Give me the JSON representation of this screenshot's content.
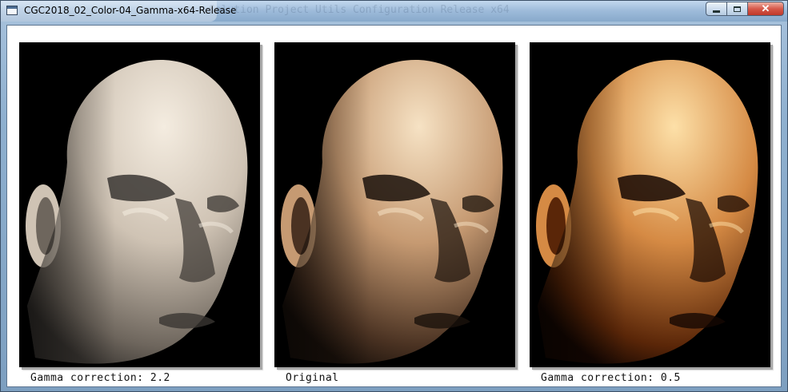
{
  "window": {
    "title": "CGC2018_02_Color-04_Gamma-x64-Release",
    "background_text": "Solution Project Utils Configuration Release x64",
    "buttons": {
      "minimize": "",
      "maximize": "",
      "close": "✕"
    }
  },
  "panels": [
    {
      "caption": "Gamma correction: 2.2",
      "tone": "pale"
    },
    {
      "caption": "Original",
      "tone": "original"
    },
    {
      "caption": "Gamma correction: 0.5",
      "tone": "saturated"
    }
  ],
  "colors": {
    "pale": {
      "light": "#f4ece0",
      "mid": "#cfc3b4",
      "dark": "#6e665d",
      "rim": "#3a3632"
    },
    "original": {
      "light": "#f6e2c4",
      "mid": "#c69a72",
      "dark": "#4a3222",
      "rim": "#1a110b"
    },
    "saturated": {
      "light": "#fde0a8",
      "mid": "#d58a44",
      "dark": "#5a2608",
      "rim": "#150702"
    }
  }
}
